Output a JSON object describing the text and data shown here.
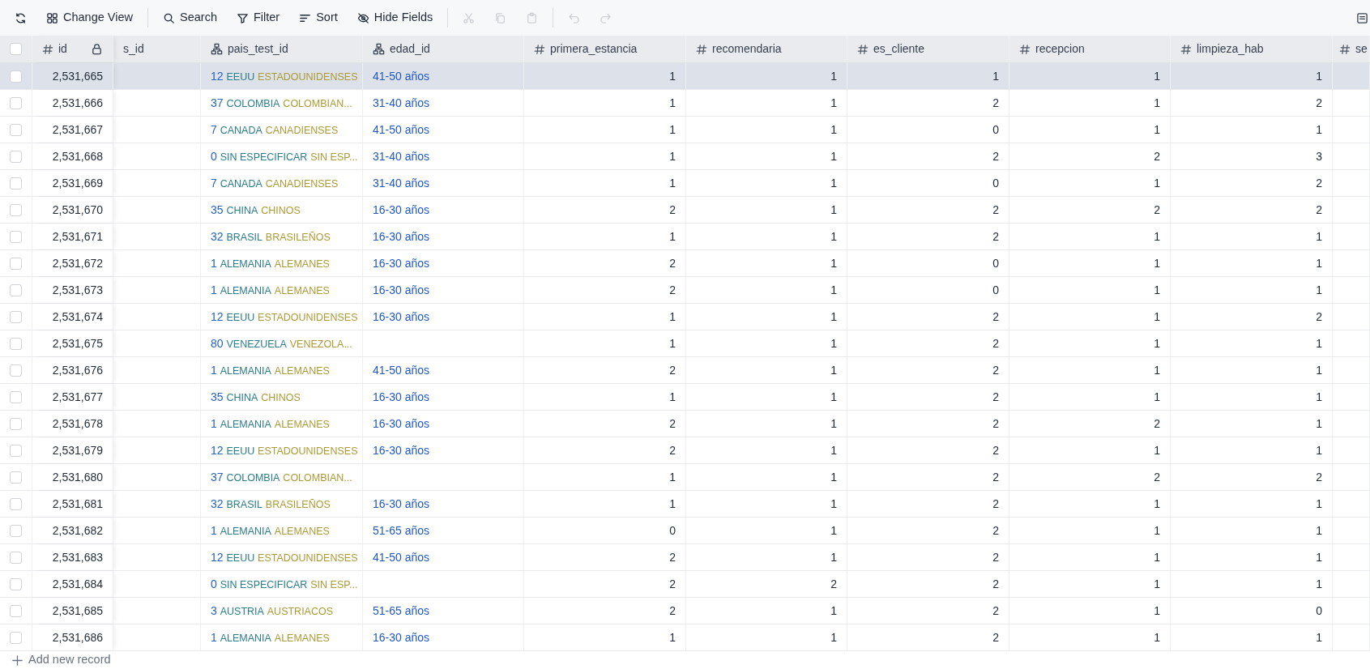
{
  "toolbar": {
    "items": [
      {
        "kind": "refresh",
        "disabled": false
      },
      {
        "kind": "view",
        "label": "Change View",
        "disabled": false
      },
      {
        "kind": "divider"
      },
      {
        "kind": "search",
        "label": "Search",
        "disabled": false
      },
      {
        "kind": "filter",
        "label": "Filter",
        "disabled": false
      },
      {
        "kind": "sort",
        "label": "Sort",
        "disabled": false
      },
      {
        "kind": "hide",
        "label": "Hide Fields",
        "disabled": false
      },
      {
        "kind": "divider"
      },
      {
        "kind": "cut",
        "disabled": true
      },
      {
        "kind": "copy",
        "disabled": true
      },
      {
        "kind": "paste",
        "disabled": true
      },
      {
        "kind": "divider"
      },
      {
        "kind": "undo",
        "disabled": true
      },
      {
        "kind": "redo",
        "disabled": true
      }
    ]
  },
  "table": {
    "select_all": {
      "checked": false
    },
    "columns": [
      {
        "label": "id",
        "kind": "number",
        "locked": true
      },
      {
        "label": "s_id",
        "kind": "plain",
        "locked": false
      },
      {
        "label": "pais_test_id",
        "kind": "link",
        "locked": false
      },
      {
        "label": "edad_id",
        "kind": "link",
        "locked": false
      },
      {
        "label": "primera_estancia",
        "kind": "number",
        "locked": false
      },
      {
        "label": "recomendaria",
        "kind": "number",
        "locked": false
      },
      {
        "label": "es_cliente",
        "kind": "number",
        "locked": false
      },
      {
        "label": "recepcion",
        "kind": "number",
        "locked": false
      },
      {
        "label": "limpieza_hab",
        "kind": "number",
        "locked": false
      },
      {
        "label": "se",
        "kind": "number"
      }
    ],
    "rows": [
      {
        "hovered": true,
        "checked": false,
        "id": "2,531,665",
        "pais": {
          "code": "12",
          "name": "EEUU",
          "people": "ESTADOUNIDENSES"
        },
        "edad": "41-50 años",
        "values": [
          "1",
          "1",
          "1",
          "1",
          "1"
        ]
      },
      {
        "hovered": false,
        "checked": false,
        "id": "2,531,666",
        "pais": {
          "code": "37",
          "name": "COLOMBIA",
          "people": "COLOMBIAN..."
        },
        "edad": "31-40 años",
        "values": [
          "1",
          "1",
          "2",
          "1",
          "2"
        ]
      },
      {
        "hovered": false,
        "checked": false,
        "id": "2,531,667",
        "pais": {
          "code": "7",
          "name": "CANADA",
          "people": "CANADIENSES"
        },
        "edad": "41-50 años",
        "values": [
          "1",
          "1",
          "0",
          "1",
          "1"
        ]
      },
      {
        "hovered": false,
        "checked": false,
        "id": "2,531,668",
        "pais": {
          "code": "0",
          "name": "SIN ESPECIFICAR",
          "people": "SIN ESP..."
        },
        "edad": "31-40 años",
        "values": [
          "1",
          "1",
          "2",
          "2",
          "3"
        ]
      },
      {
        "hovered": false,
        "checked": false,
        "id": "2,531,669",
        "pais": {
          "code": "7",
          "name": "CANADA",
          "people": "CANADIENSES"
        },
        "edad": "31-40 años",
        "values": [
          "1",
          "1",
          "0",
          "1",
          "2"
        ]
      },
      {
        "hovered": false,
        "checked": false,
        "id": "2,531,670",
        "pais": {
          "code": "35",
          "name": "CHINA",
          "people": "CHINOS"
        },
        "edad": "16-30 años",
        "values": [
          "2",
          "1",
          "2",
          "2",
          "2"
        ]
      },
      {
        "hovered": false,
        "checked": false,
        "id": "2,531,671",
        "pais": {
          "code": "32",
          "name": "BRASIL",
          "people": "BRASILEÑOS"
        },
        "edad": "16-30 años",
        "values": [
          "1",
          "1",
          "2",
          "1",
          "1"
        ]
      },
      {
        "hovered": false,
        "checked": false,
        "id": "2,531,672",
        "pais": {
          "code": "1",
          "name": "ALEMANIA",
          "people": "ALEMANES"
        },
        "edad": "16-30 años",
        "values": [
          "2",
          "1",
          "0",
          "1",
          "1"
        ]
      },
      {
        "hovered": false,
        "checked": false,
        "id": "2,531,673",
        "pais": {
          "code": "1",
          "name": "ALEMANIA",
          "people": "ALEMANES"
        },
        "edad": "16-30 años",
        "values": [
          "2",
          "1",
          "0",
          "1",
          "1"
        ]
      },
      {
        "hovered": false,
        "checked": false,
        "id": "2,531,674",
        "pais": {
          "code": "12",
          "name": "EEUU",
          "people": "ESTADOUNIDENSES"
        },
        "edad": "16-30 años",
        "values": [
          "1",
          "1",
          "2",
          "1",
          "2"
        ]
      },
      {
        "hovered": false,
        "checked": false,
        "id": "2,531,675",
        "pais": {
          "code": "80",
          "name": "VENEZUELA",
          "people": "VENEZOLA..."
        },
        "values": [
          "1",
          "1",
          "2",
          "1",
          "1"
        ]
      },
      {
        "hovered": false,
        "checked": false,
        "id": "2,531,676",
        "pais": {
          "code": "1",
          "name": "ALEMANIA",
          "people": "ALEMANES"
        },
        "edad": "41-50 años",
        "values": [
          "2",
          "1",
          "2",
          "1",
          "1"
        ]
      },
      {
        "hovered": false,
        "checked": false,
        "id": "2,531,677",
        "pais": {
          "code": "35",
          "name": "CHINA",
          "people": "CHINOS"
        },
        "edad": "16-30 años",
        "values": [
          "1",
          "1",
          "2",
          "1",
          "1"
        ]
      },
      {
        "hovered": false,
        "checked": false,
        "id": "2,531,678",
        "pais": {
          "code": "1",
          "name": "ALEMANIA",
          "people": "ALEMANES"
        },
        "edad": "16-30 años",
        "values": [
          "2",
          "1",
          "2",
          "2",
          "1"
        ]
      },
      {
        "hovered": false,
        "checked": false,
        "id": "2,531,679",
        "pais": {
          "code": "12",
          "name": "EEUU",
          "people": "ESTADOUNIDENSES"
        },
        "edad": "16-30 años",
        "values": [
          "2",
          "1",
          "2",
          "1",
          "1"
        ]
      },
      {
        "hovered": false,
        "checked": false,
        "id": "2,531,680",
        "pais": {
          "code": "37",
          "name": "COLOMBIA",
          "people": "COLOMBIAN..."
        },
        "values": [
          "1",
          "1",
          "2",
          "2",
          "2"
        ]
      },
      {
        "hovered": false,
        "checked": false,
        "id": "2,531,681",
        "pais": {
          "code": "32",
          "name": "BRASIL",
          "people": "BRASILEÑOS"
        },
        "edad": "16-30 años",
        "values": [
          "1",
          "1",
          "2",
          "1",
          "1"
        ]
      },
      {
        "hovered": false,
        "checked": false,
        "id": "2,531,682",
        "pais": {
          "code": "1",
          "name": "ALEMANIA",
          "people": "ALEMANES"
        },
        "edad": "51-65 años",
        "values": [
          "0",
          "1",
          "2",
          "1",
          "1"
        ]
      },
      {
        "hovered": false,
        "checked": false,
        "id": "2,531,683",
        "pais": {
          "code": "12",
          "name": "EEUU",
          "people": "ESTADOUNIDENSES"
        },
        "edad": "41-50 años",
        "values": [
          "2",
          "1",
          "2",
          "1",
          "1"
        ]
      },
      {
        "hovered": false,
        "checked": false,
        "id": "2,531,684",
        "pais": {
          "code": "0",
          "name": "SIN ESPECIFICAR",
          "people": "SIN ESP..."
        },
        "values": [
          "2",
          "2",
          "2",
          "1",
          "1"
        ]
      },
      {
        "hovered": false,
        "checked": false,
        "id": "2,531,685",
        "pais": {
          "code": "3",
          "name": "AUSTRIA",
          "people": "AUSTRIACOS"
        },
        "edad": "51-65 años",
        "values": [
          "2",
          "1",
          "2",
          "1",
          "0"
        ]
      },
      {
        "hovered": false,
        "checked": false,
        "id": "2,531,686",
        "pais": {
          "code": "1",
          "name": "ALEMANIA",
          "people": "ALEMANES"
        },
        "edad": "16-30 años",
        "values": [
          "1",
          "1",
          "2",
          "1",
          "1"
        ]
      }
    ]
  },
  "add_record": {
    "label": "Add new record"
  }
}
